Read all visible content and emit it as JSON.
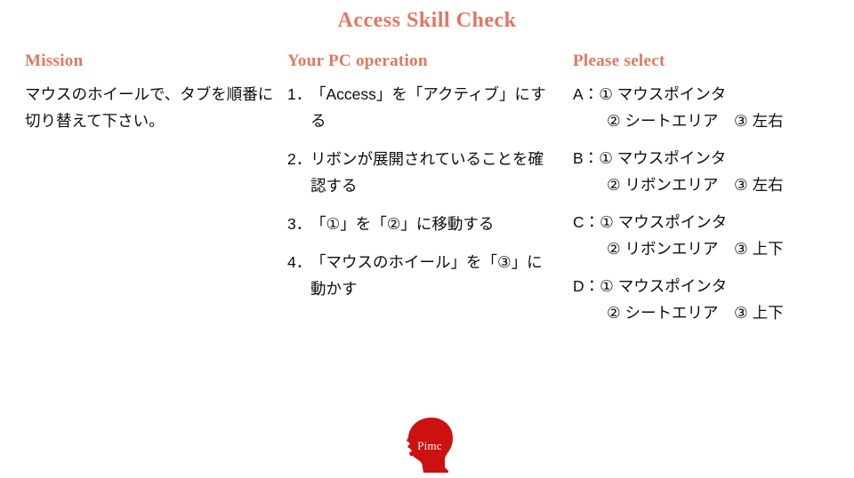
{
  "slide": {
    "title": "Access Skill Check",
    "accent_color": "#e0785f",
    "text_color": "#0d0d0d",
    "background_color": "#ffffff"
  },
  "mission": {
    "heading": "Mission",
    "body": "マウスのホイールで、タブを順番に切り替えて下さい。"
  },
  "operation": {
    "heading": "Your PC operation",
    "steps": [
      {
        "number": "1．",
        "text": "「Access」を「アクティブ」にする"
      },
      {
        "number": "2．",
        "text": "リボンが展開されていることを確認する"
      },
      {
        "number": "3．",
        "text": "「①」を「②」に移動する"
      },
      {
        "number": "4．",
        "text": "「マウスのホイール」を「③」に動かす"
      }
    ]
  },
  "select": {
    "heading": "Please select",
    "options": [
      {
        "key": "A：",
        "line1": "① マウスポインタ",
        "line2": "② シートエリア　③ 左右"
      },
      {
        "key": "B：",
        "line1": "① マウスポインタ",
        "line2": "② リボンエリア　③ 左右"
      },
      {
        "key": "C：",
        "line1": "① マウスポインタ",
        "line2": "② リボンエリア　③ 上下"
      },
      {
        "key": "D：",
        "line1": "① マウスポインタ",
        "line2": "② シートエリア　③ 上下"
      }
    ]
  },
  "logo": {
    "word": "Pimc",
    "color": "#cc1111"
  }
}
